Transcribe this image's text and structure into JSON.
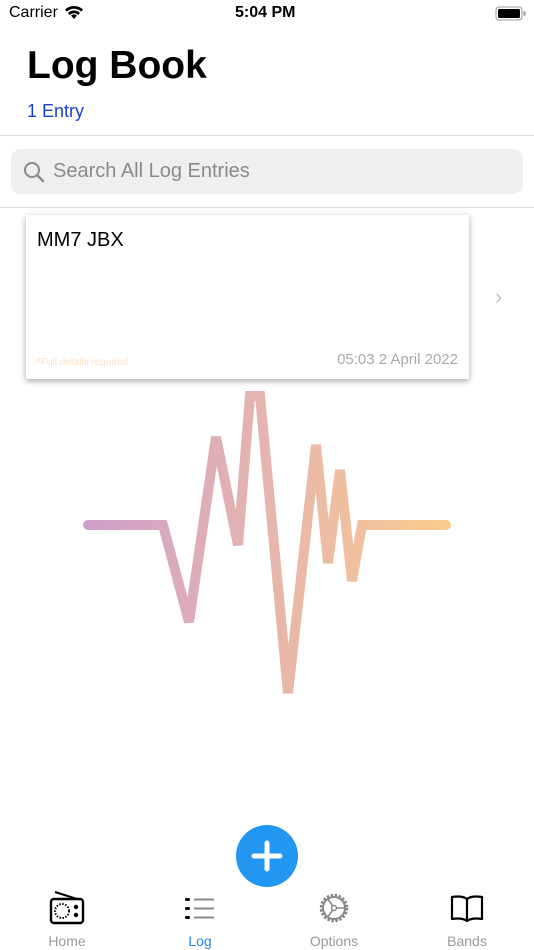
{
  "status": {
    "carrier": "Carrier",
    "time": "5:04 PM"
  },
  "header": {
    "title": "Log Book",
    "count": "1 Entry"
  },
  "search": {
    "placeholder": "Search All Log Entries"
  },
  "entries": [
    {
      "callsign": "MM7 JBX",
      "note": "*Full details required",
      "datetime": "05:03 2 April 2022"
    }
  ],
  "colors": {
    "accent": "#2196f3",
    "wave_start": "#cf9fcb",
    "wave_end": "#fccb8f"
  },
  "tabs": [
    {
      "label": "Home",
      "icon": "radio-icon"
    },
    {
      "label": "Log",
      "icon": "list-icon",
      "active": true
    },
    {
      "label": "Options",
      "icon": "gear-icon"
    },
    {
      "label": "Bands",
      "icon": "book-icon"
    }
  ]
}
